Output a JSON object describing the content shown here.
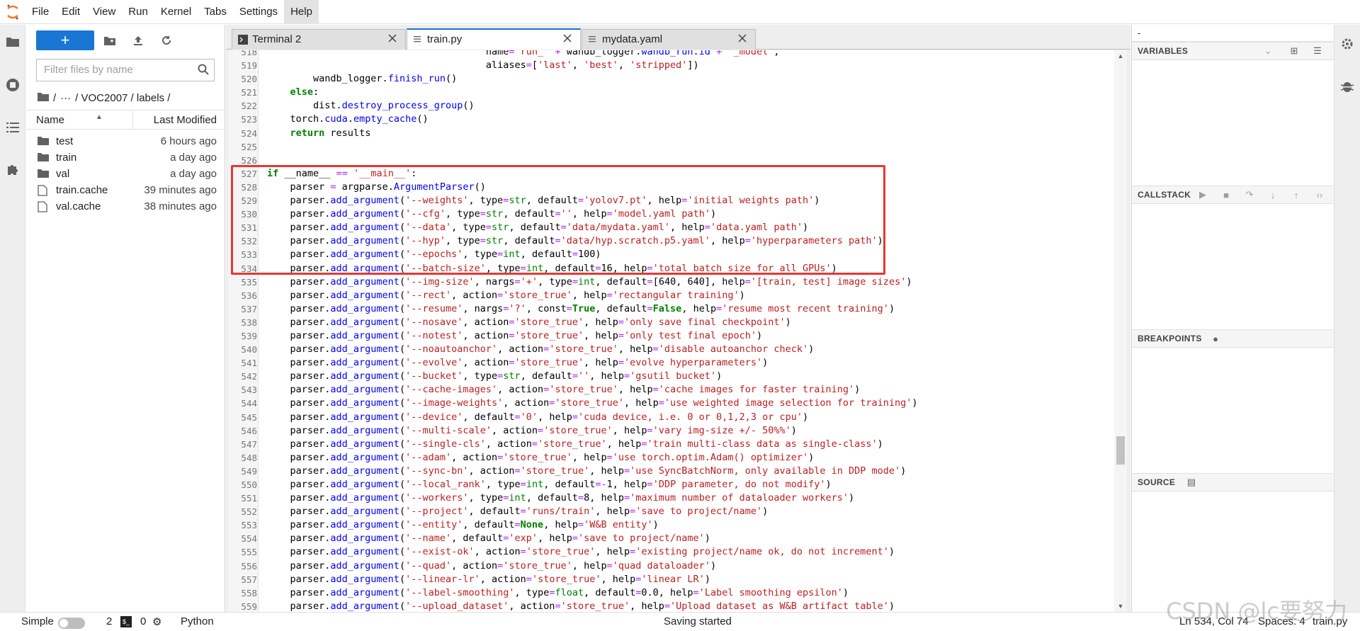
{
  "menu": [
    "File",
    "Edit",
    "View",
    "Run",
    "Kernel",
    "Tabs",
    "Settings",
    "Help"
  ],
  "file_browser": {
    "new_label": "+",
    "search_placeholder": "Filter files by name",
    "breadcrumb": [
      "/",
      "···",
      "/ VOC2007 / labels /"
    ],
    "col_name": "Name",
    "col_modified": "Last Modified",
    "items": [
      {
        "name": "test",
        "type": "folder",
        "modified": "6 hours ago"
      },
      {
        "name": "train",
        "type": "folder",
        "modified": "a day ago"
      },
      {
        "name": "val",
        "type": "folder",
        "modified": "a day ago"
      },
      {
        "name": "train.cache",
        "type": "file",
        "modified": "39 minutes ago"
      },
      {
        "name": "val.cache",
        "type": "file",
        "modified": "38 minutes ago"
      }
    ]
  },
  "tabs": [
    {
      "label": "Terminal 2",
      "icon": "terminal-icon"
    },
    {
      "label": "train.py",
      "icon": "file-icon"
    },
    {
      "label": "mydata.yaml",
      "icon": "file-icon"
    }
  ],
  "code": [
    {
      "n": "518",
      "t": "                                      name='run_' + wandb_logger.wandb_run.id + '_model',"
    },
    {
      "n": "519",
      "t": "                                      aliases=['last', 'best', 'stripped'])"
    },
    {
      "n": "520",
      "t": "        wandb_logger.finish_run()"
    },
    {
      "n": "521",
      "t": "    else:"
    },
    {
      "n": "522",
      "t": "        dist.destroy_process_group()"
    },
    {
      "n": "523",
      "t": "    torch.cuda.empty_cache()"
    },
    {
      "n": "524",
      "t": "    return results"
    },
    {
      "n": "525",
      "t": ""
    },
    {
      "n": "526",
      "t": ""
    },
    {
      "n": "527",
      "t": "if __name__ == '__main__':"
    },
    {
      "n": "528",
      "t": "    parser = argparse.ArgumentParser()"
    },
    {
      "n": "529",
      "t": "    parser.add_argument('--weights', type=str, default='yolov7.pt', help='initial weights path')"
    },
    {
      "n": "530",
      "t": "    parser.add_argument('--cfg', type=str, default='', help='model.yaml path')"
    },
    {
      "n": "531",
      "t": "    parser.add_argument('--data', type=str, default='data/mydata.yaml', help='data.yaml path')"
    },
    {
      "n": "532",
      "t": "    parser.add_argument('--hyp', type=str, default='data/hyp.scratch.p5.yaml', help='hyperparameters path')"
    },
    {
      "n": "533",
      "t": "    parser.add_argument('--epochs', type=int, default=100)"
    },
    {
      "n": "534",
      "t": "    parser.add_argument('--batch-size', type=int, default=16, help='total batch size for all GPUs')"
    },
    {
      "n": "535",
      "t": "    parser.add_argument('--img-size', nargs='+', type=int, default=[640, 640], help='[train, test] image sizes')"
    },
    {
      "n": "536",
      "t": "    parser.add_argument('--rect', action='store_true', help='rectangular training')"
    },
    {
      "n": "537",
      "t": "    parser.add_argument('--resume', nargs='?', const=True, default=False, help='resume most recent training')"
    },
    {
      "n": "538",
      "t": "    parser.add_argument('--nosave', action='store_true', help='only save final checkpoint')"
    },
    {
      "n": "539",
      "t": "    parser.add_argument('--notest', action='store_true', help='only test final epoch')"
    },
    {
      "n": "540",
      "t": "    parser.add_argument('--noautoanchor', action='store_true', help='disable autoanchor check')"
    },
    {
      "n": "541",
      "t": "    parser.add_argument('--evolve', action='store_true', help='evolve hyperparameters')"
    },
    {
      "n": "542",
      "t": "    parser.add_argument('--bucket', type=str, default='', help='gsutil bucket')"
    },
    {
      "n": "543",
      "t": "    parser.add_argument('--cache-images', action='store_true', help='cache images for faster training')"
    },
    {
      "n": "544",
      "t": "    parser.add_argument('--image-weights', action='store_true', help='use weighted image selection for training')"
    },
    {
      "n": "545",
      "t": "    parser.add_argument('--device', default='0', help='cuda device, i.e. 0 or 0,1,2,3 or cpu')"
    },
    {
      "n": "546",
      "t": "    parser.add_argument('--multi-scale', action='store_true', help='vary img-size +/- 50%%')"
    },
    {
      "n": "547",
      "t": "    parser.add_argument('--single-cls', action='store_true', help='train multi-class data as single-class')"
    },
    {
      "n": "548",
      "t": "    parser.add_argument('--adam', action='store_true', help='use torch.optim.Adam() optimizer')"
    },
    {
      "n": "549",
      "t": "    parser.add_argument('--sync-bn', action='store_true', help='use SyncBatchNorm, only available in DDP mode')"
    },
    {
      "n": "550",
      "t": "    parser.add_argument('--local_rank', type=int, default=-1, help='DDP parameter, do not modify')"
    },
    {
      "n": "551",
      "t": "    parser.add_argument('--workers', type=int, default=8, help='maximum number of dataloader workers')"
    },
    {
      "n": "552",
      "t": "    parser.add_argument('--project', default='runs/train', help='save to project/name')"
    },
    {
      "n": "553",
      "t": "    parser.add_argument('--entity', default=None, help='W&B entity')"
    },
    {
      "n": "554",
      "t": "    parser.add_argument('--name', default='exp', help='save to project/name')"
    },
    {
      "n": "555",
      "t": "    parser.add_argument('--exist-ok', action='store_true', help='existing project/name ok, do not increment')"
    },
    {
      "n": "556",
      "t": "    parser.add_argument('--quad', action='store_true', help='quad dataloader')"
    },
    {
      "n": "557",
      "t": "    parser.add_argument('--linear-lr', action='store_true', help='linear LR')"
    },
    {
      "n": "558",
      "t": "    parser.add_argument('--label-smoothing', type=float, default=0.0, help='Label smoothing epsilon')"
    },
    {
      "n": "559",
      "t": "    parser.add_argument('--upload_dataset', action='store_true', help='Upload dataset as W&B artifact table')"
    }
  ],
  "debugger": {
    "top_value": "-",
    "variables": "VARIABLES",
    "callstack": "CALLSTACK",
    "breakpoints": "BREAKPOINTS",
    "source": "SOURCE"
  },
  "status": {
    "mode": "Simple",
    "terminals": "2",
    "kernels": "0",
    "language": "Python",
    "message": "Saving started",
    "position": "Ln 534, Col 74",
    "spaces": "Spaces: 4",
    "filename": "train.py"
  },
  "watermark": "CSDN @lc要努力",
  "colors": {
    "accent": "#1976d2",
    "highlight_box": "#e53935"
  }
}
